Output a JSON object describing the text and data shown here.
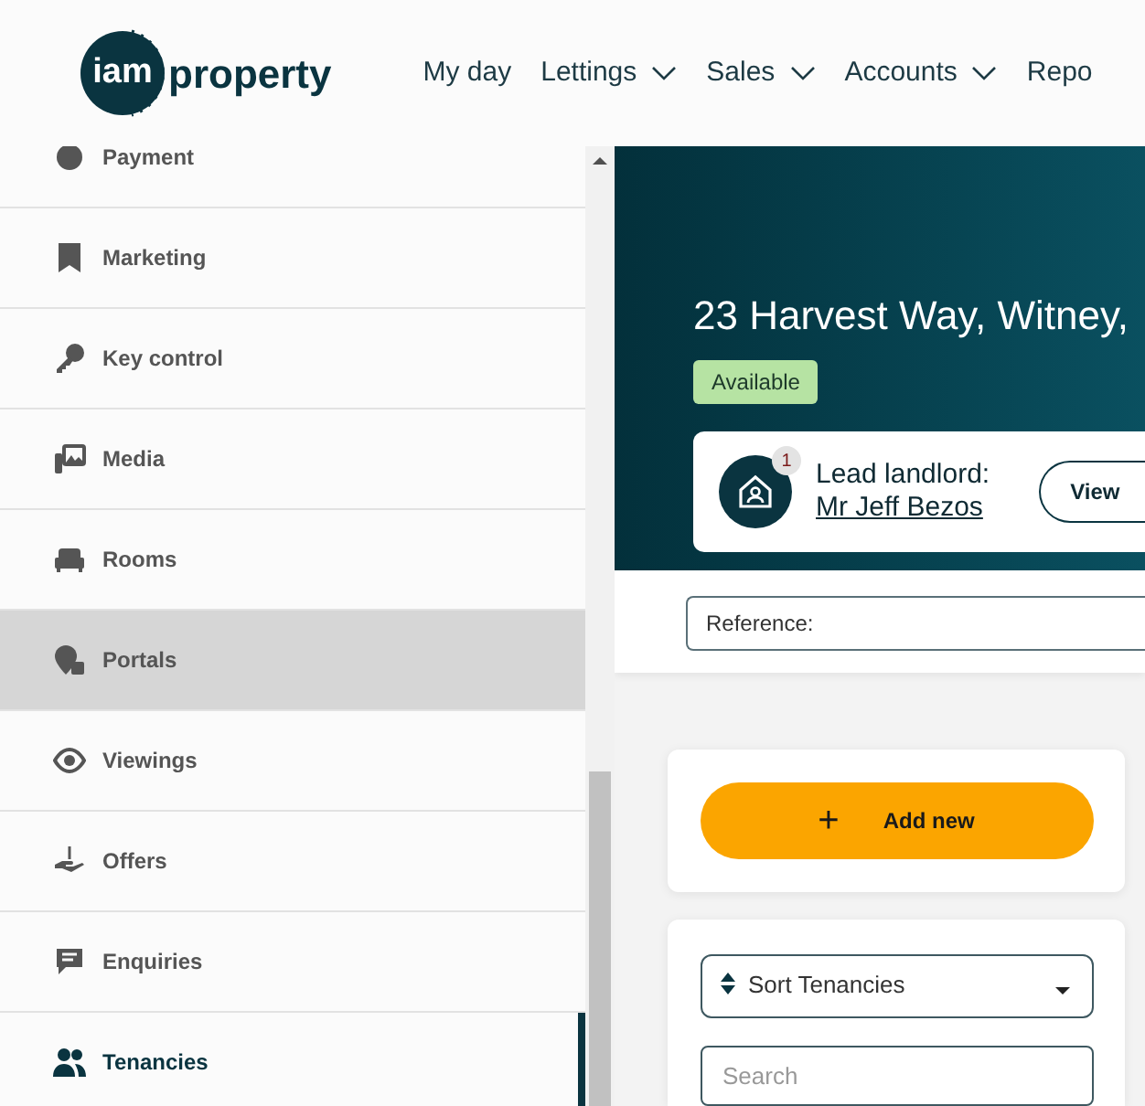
{
  "header": {
    "logo": {
      "mark": "iam",
      "word": "property"
    },
    "nav": [
      {
        "label": "My day",
        "dropdown": false
      },
      {
        "label": "Lettings",
        "dropdown": true
      },
      {
        "label": "Sales",
        "dropdown": true
      },
      {
        "label": "Accounts",
        "dropdown": true
      },
      {
        "label": "Repo",
        "dropdown": false
      }
    ]
  },
  "sidebar": {
    "items": [
      {
        "label": "Payment",
        "kind": "payment",
        "selected": false,
        "highlighted": false
      },
      {
        "label": "Marketing",
        "kind": "bookmark",
        "selected": false,
        "highlighted": false
      },
      {
        "label": "Key control",
        "kind": "key",
        "selected": false,
        "highlighted": false
      },
      {
        "label": "Media",
        "kind": "media",
        "selected": false,
        "highlighted": false
      },
      {
        "label": "Rooms",
        "kind": "sofa",
        "selected": false,
        "highlighted": false
      },
      {
        "label": "Portals",
        "kind": "pin",
        "selected": false,
        "highlighted": true
      },
      {
        "label": "Viewings",
        "kind": "eye",
        "selected": false,
        "highlighted": false
      },
      {
        "label": "Offers",
        "kind": "hand",
        "selected": false,
        "highlighted": false
      },
      {
        "label": "Enquiries",
        "kind": "chat",
        "selected": false,
        "highlighted": false
      },
      {
        "label": "Tenancies",
        "kind": "people",
        "selected": true,
        "highlighted": false
      }
    ]
  },
  "property": {
    "address": "23 Harvest Way, Witney,",
    "status": "Available",
    "landlord": {
      "badge": "1",
      "label": "Lead landlord:",
      "name": "Mr Jeff Bezos",
      "button": "View"
    },
    "reference": {
      "label": "Reference:"
    }
  },
  "actions": {
    "add_button": {
      "icon": "+",
      "label": "Add new"
    }
  },
  "filters": {
    "sort": {
      "label": "Sort Tenancies"
    },
    "search": {
      "placeholder": "Search"
    }
  }
}
